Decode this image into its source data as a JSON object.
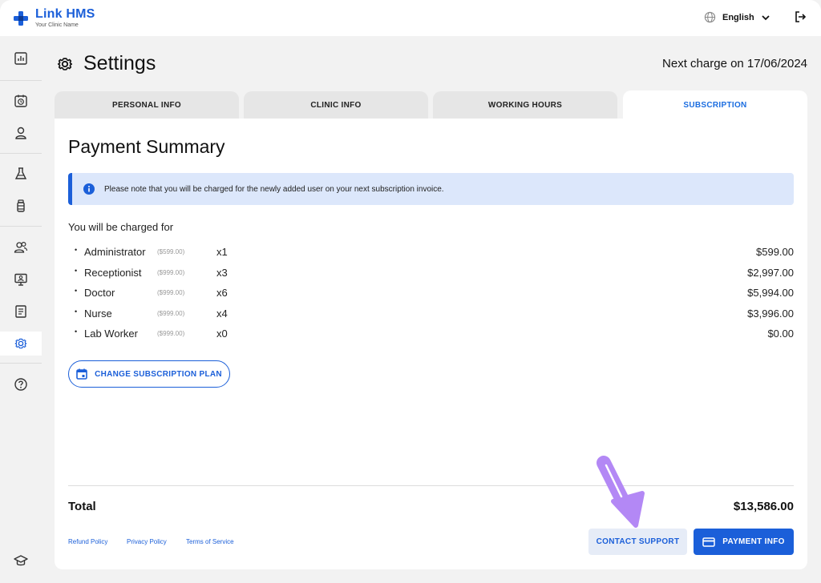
{
  "brand": {
    "name": "Link HMS",
    "tagline": "Your Clinic Name",
    "color": "#1b5fd9"
  },
  "topbar": {
    "language": "English"
  },
  "sidebar": {
    "items": [
      {
        "icon": "dashboard-icon"
      },
      {
        "icon": "calendar-clock-icon"
      },
      {
        "icon": "person-icon"
      },
      {
        "icon": "flask-icon"
      },
      {
        "icon": "bottle-icon"
      },
      {
        "icon": "users-icon"
      },
      {
        "icon": "monitor-user-icon"
      },
      {
        "icon": "report-icon"
      },
      {
        "icon": "gear-icon",
        "active": true
      },
      {
        "icon": "help-icon"
      },
      {
        "icon": "graduation-cap-icon"
      }
    ]
  },
  "header": {
    "title": "Settings",
    "next_charge": "Next charge on 17/06/2024"
  },
  "tabs": [
    {
      "label": "PERSONAL INFO"
    },
    {
      "label": "CLINIC INFO"
    },
    {
      "label": "WORKING HOURS"
    },
    {
      "label": "SUBSCRIPTION",
      "active": true
    }
  ],
  "summary": {
    "title": "Payment Summary",
    "notice": "Please note that you will be charged for the newly added user on your next subscription invoice.",
    "charged_for": "You will be charged for",
    "items": [
      {
        "name": "Administrator",
        "unit_price": "($599.00)",
        "qty": "x1",
        "amount": "$599.00"
      },
      {
        "name": "Receptionist",
        "unit_price": "($999.00)",
        "qty": "x3",
        "amount": "$2,997.00"
      },
      {
        "name": "Doctor",
        "unit_price": "($999.00)",
        "qty": "x6",
        "amount": "$5,994.00"
      },
      {
        "name": "Nurse",
        "unit_price": "($999.00)",
        "qty": "x4",
        "amount": "$3,996.00"
      },
      {
        "name": "Lab Worker",
        "unit_price": "($999.00)",
        "qty": "x0",
        "amount": "$0.00"
      }
    ],
    "change_plan_label": "CHANGE SUBSCRIPTION PLAN",
    "total_label": "Total",
    "total_value": "$13,586.00"
  },
  "footer": {
    "links": [
      "Refund Policy",
      "Privacy Policy",
      "Terms of Service"
    ],
    "contact_support": "CONTACT SUPPORT",
    "payment_info": "PAYMENT INFO"
  },
  "colors": {
    "accent": "#1b5fd9",
    "notice_bg": "#dce7fb",
    "arrow": "#b388f5"
  }
}
